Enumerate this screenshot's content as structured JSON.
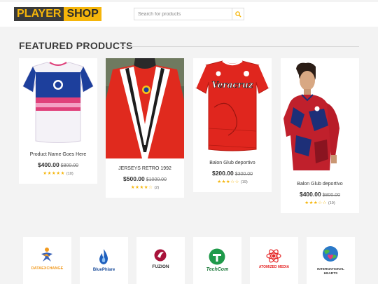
{
  "header": {
    "logo_part1": "PLAYER",
    "logo_part2": "SHOP",
    "search_placeholder": "Search for products"
  },
  "featured": {
    "title": "FEATURED PRODUCTS",
    "products": [
      {
        "name": "Product Name Goes Here",
        "price": "$400.00",
        "old_price": "$800.00",
        "stars": "★★★★★",
        "count": "(10)",
        "rating": 5
      },
      {
        "name": "JERSEYS RETRO 1992",
        "price": "$500.00",
        "old_price": "$1000.00",
        "stars": "★★★★☆",
        "count": "(2)",
        "rating": 4.5
      },
      {
        "name": "Balon Glub deportivo",
        "price": "$200.00",
        "old_price": "$300.00",
        "stars": "★★★☆☆",
        "count": "(19)",
        "rating": 3.5
      },
      {
        "name": "Balon Glub deportivo",
        "price": "$400.00",
        "old_price": "$800.00",
        "stars": "★★★☆☆",
        "count": "(19)",
        "rating": 3.5
      }
    ]
  },
  "brands": [
    {
      "name": "DATAEXCHANGE"
    },
    {
      "name": "BluePhlare"
    },
    {
      "name": "FUZION"
    },
    {
      "name": "TechCom"
    },
    {
      "name": "ATOMIZED MEDIA"
    },
    {
      "name": "INTERNATIONAL HEARTS"
    }
  ],
  "colors": {
    "accent": "#f5b50a",
    "dark": "#3a3a3a",
    "background": "#f3f3f3"
  }
}
